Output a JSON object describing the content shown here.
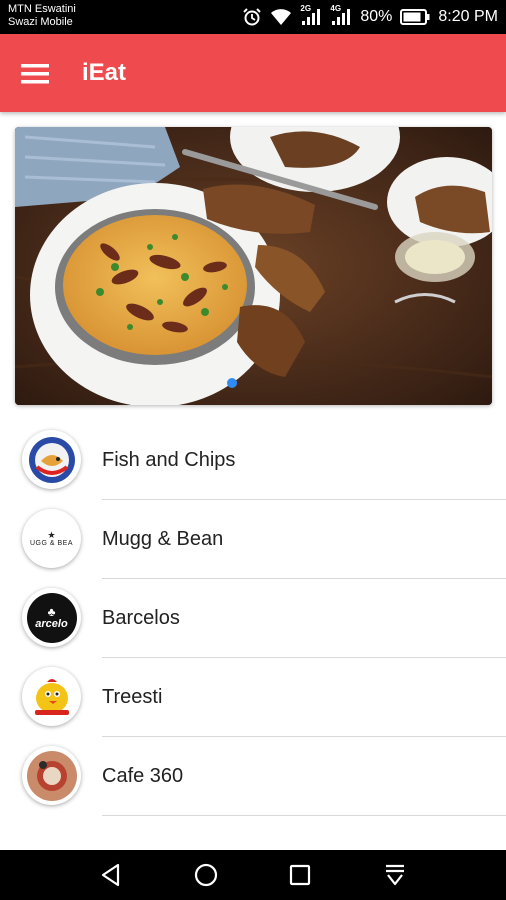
{
  "status_bar": {
    "carrier_line1": "MTN Eswatini",
    "carrier_line2": "Swazi Mobile",
    "network1": "2G",
    "network2": "4G",
    "battery": "80%",
    "time": "8:20 PM"
  },
  "app_bar": {
    "title": "iEat",
    "color": "#ef4a4d"
  },
  "banner": {
    "active_slide": 1,
    "indicator_color": "#2f8cf4"
  },
  "restaurants": [
    {
      "name": "Fish and Chips",
      "logo_icon": "fish-and-chips-logo"
    },
    {
      "name": "Mugg & Bean",
      "logo_icon": "mugg-and-bean-logo",
      "logo_text": "UGG & BEA"
    },
    {
      "name": "Barcelos",
      "logo_icon": "barcelos-logo",
      "logo_text": "arcelo"
    },
    {
      "name": "Treesti",
      "logo_icon": "treesti-logo"
    },
    {
      "name": "Cafe 360",
      "logo_icon": "cafe-360-logo"
    }
  ],
  "nav_bar": {
    "buttons": [
      "back-icon",
      "home-icon",
      "recents-icon",
      "notifications-pull-icon"
    ]
  }
}
